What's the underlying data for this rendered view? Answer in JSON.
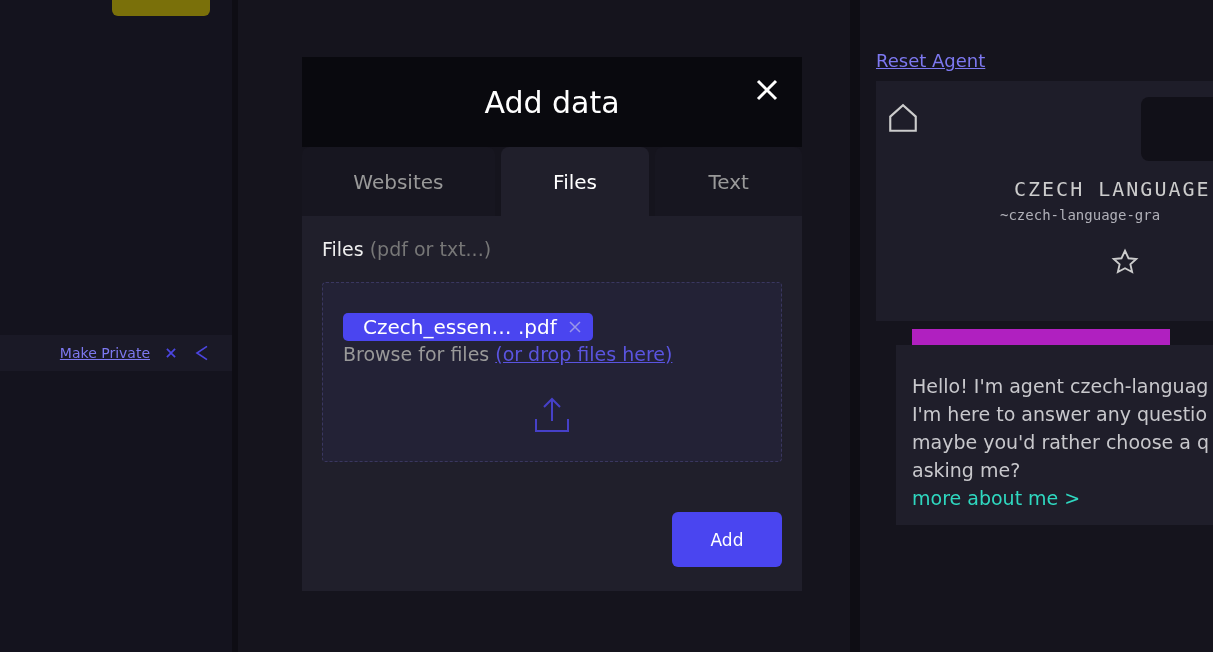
{
  "background": {
    "left_panel": {
      "link": "Make Private"
    },
    "right_panel": {
      "reset_link": "Reset Agent",
      "agent_name": "CZECH LANGUAGE",
      "agent_handle": "~czech-language-gra",
      "message_lines": [
        "Hello! I'm agent czech-languag",
        "I'm here to answer any questio",
        "maybe you'd rather choose a q",
        "asking me?"
      ],
      "more_link": "more about me >"
    }
  },
  "dialog": {
    "title": "Add data",
    "tabs": [
      {
        "label": "Websites",
        "selected": false
      },
      {
        "label": "Files",
        "selected": true
      },
      {
        "label": "Text",
        "selected": false
      }
    ],
    "field_label": "Files",
    "field_hint": "(pdf or txt...)",
    "files": [
      {
        "name": "Czech_essen… .pdf"
      }
    ],
    "browse_text": "Browse for files",
    "drop_link": "(or drop files here)",
    "add_button": "Add"
  }
}
